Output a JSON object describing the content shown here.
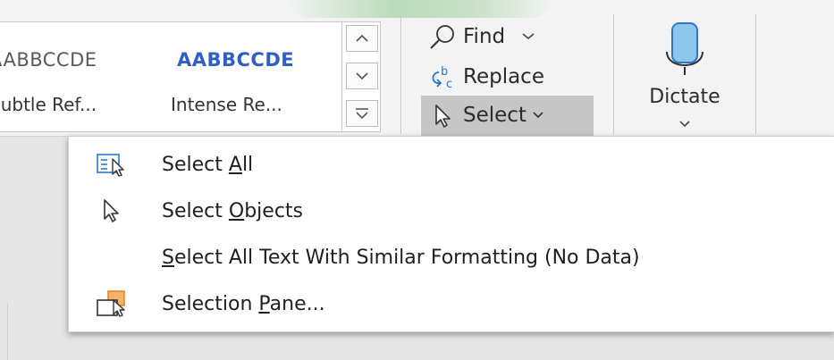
{
  "styles_gallery": {
    "items": [
      {
        "sample": "AABBCCDE",
        "name": "Subtle Ref...",
        "sample_color": "#595959"
      },
      {
        "sample": "AABBCCDE",
        "name": "Intense Re...",
        "sample_color": "#2f5ec4"
      }
    ]
  },
  "editing_group": {
    "find_label": "Find",
    "replace_label": "Replace",
    "select_label": "Select"
  },
  "voice_group": {
    "dictate_label": "Dictate"
  },
  "select_menu": {
    "items": [
      {
        "prefix": "Select ",
        "accel": "A",
        "suffix": "ll",
        "icon": "select-all-icon"
      },
      {
        "prefix": "Select ",
        "accel": "O",
        "suffix": "bjects",
        "icon": "select-objects-icon"
      },
      {
        "prefix": "",
        "accel": "S",
        "suffix": "elect All Text With Similar Formatting (No Data)",
        "icon": "none"
      },
      {
        "prefix": "Selection ",
        "accel": "P",
        "suffix": "ane...",
        "icon": "selection-pane-icon"
      }
    ]
  },
  "colors": {
    "accent_blue": "#2f5ec4",
    "icon_blue": "#2b78c5",
    "icon_orange": "#e8862a"
  }
}
